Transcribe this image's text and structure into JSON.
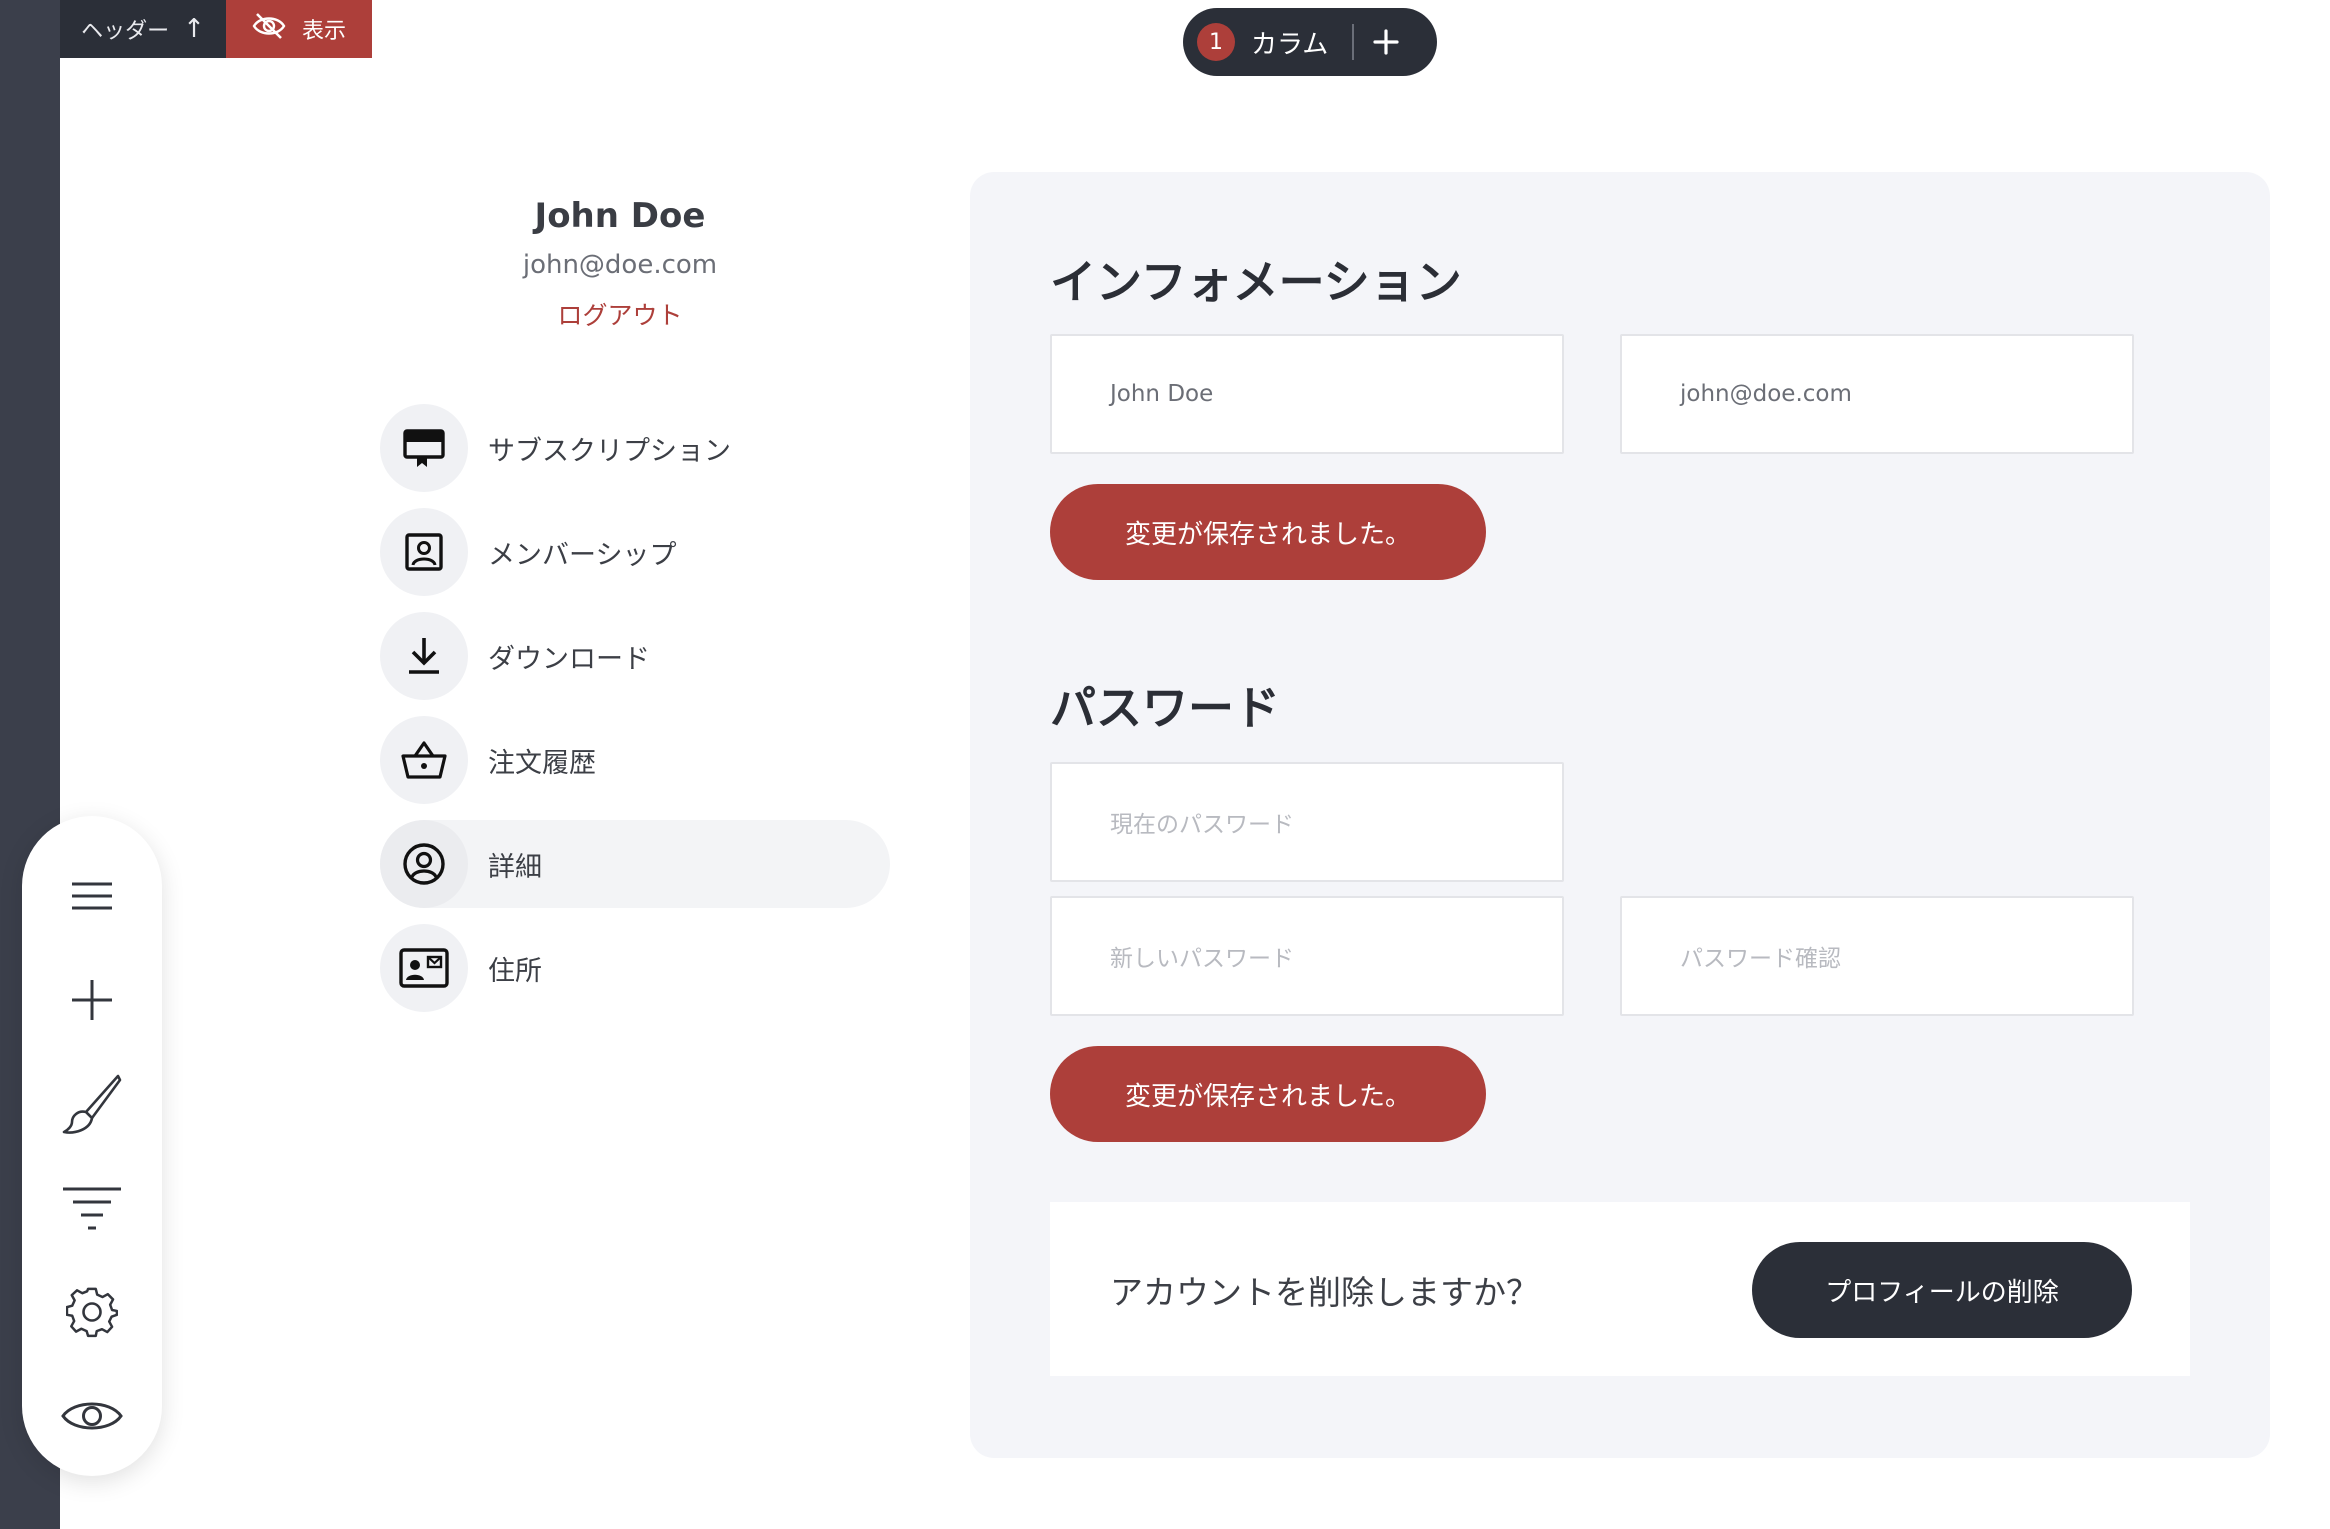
{
  "editor": {
    "header_label": "ヘッダー",
    "header_arrow": "↑",
    "visibility_label": "表示",
    "column_badge": "1",
    "column_label": "カラム"
  },
  "tools": [
    {
      "icon": "hamburger-menu-icon"
    },
    {
      "icon": "plus-icon"
    },
    {
      "icon": "paintbrush-icon"
    },
    {
      "icon": "filter-icon"
    },
    {
      "icon": "gear-icon"
    },
    {
      "icon": "eye-icon"
    }
  ],
  "profile": {
    "name": "John Doe",
    "email": "john@doe.com",
    "logout": "ログアウト"
  },
  "menu": [
    {
      "label": "サブスクリプション",
      "icon": "subscription-certificate-icon",
      "active": false
    },
    {
      "label": "メンバーシップ",
      "icon": "membership-card-icon",
      "active": false
    },
    {
      "label": "ダウンロード",
      "icon": "download-icon",
      "active": false
    },
    {
      "label": "注文履歴",
      "icon": "shopping-basket-icon",
      "active": false
    },
    {
      "label": "詳細",
      "icon": "user-circle-icon",
      "active": true
    },
    {
      "label": "住所",
      "icon": "address-card-icon",
      "active": false
    }
  ],
  "information": {
    "title": "インフォメーション",
    "name_value": "John Doe",
    "email_value": "john@doe.com",
    "save_label": "変更が保存されました。"
  },
  "password": {
    "title": "パスワード",
    "current_placeholder": "現在のパスワード",
    "new_placeholder": "新しいパスワード",
    "confirm_placeholder": "パスワード確認",
    "save_label": "変更が保存されました。"
  },
  "delete_account": {
    "question": "アカウントを削除しますか？",
    "button_label": "プロフィールの削除"
  },
  "colors": {
    "accent": "#ad3f3a",
    "dark": "#2b2f38",
    "panel_bg": "#f4f5f9"
  }
}
